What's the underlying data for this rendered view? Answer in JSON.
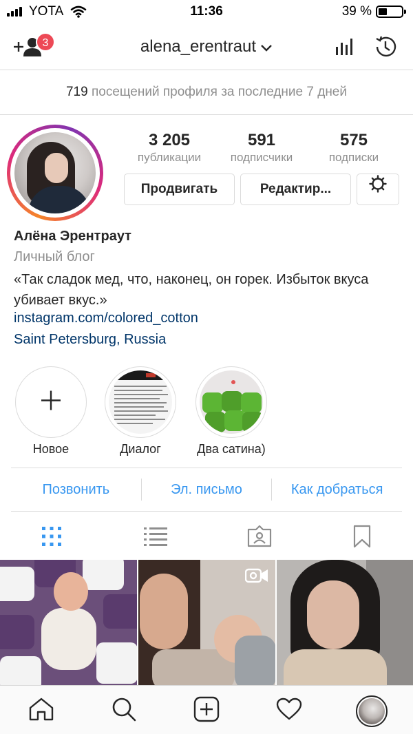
{
  "status_bar": {
    "carrier": "YOTA",
    "time": "11:36",
    "battery_percent": "39 %",
    "battery_level": 0.39
  },
  "header": {
    "username": "alena_erentraut",
    "notification_count": "3",
    "icons": [
      "add-user-icon",
      "chevron-down-icon",
      "insights-icon",
      "archive-history-icon"
    ]
  },
  "visits": {
    "count": "719",
    "text": "посещений профиля за последние 7 дней"
  },
  "profile": {
    "stats": [
      {
        "value": "3 205",
        "label": "публикации"
      },
      {
        "value": "591",
        "label": "подписчики"
      },
      {
        "value": "575",
        "label": "подписки"
      }
    ],
    "buttons": {
      "promote": "Продвигать",
      "edit": "Редактир..."
    },
    "full_name": "Алёна Эрентраут",
    "category": "Личный блог",
    "bio": "«Так сладок мед, что, наконец, он горек. Избыток вкуса убивает вкус.»",
    "link": "instagram.com/colored_cotton",
    "location": "Saint Petersburg, Russia"
  },
  "highlights": [
    {
      "label": "Новое"
    },
    {
      "label": "Диалог"
    },
    {
      "label": "Два сатина)"
    }
  ],
  "contact": {
    "call": "Позвонить",
    "email": "Эл. письмо",
    "directions": "Как добраться"
  },
  "tabs": [
    "grid-icon",
    "list-icon",
    "tagged-icon",
    "saved-icon"
  ],
  "colors": {
    "accent": "#3897f0",
    "link": "#003569",
    "badge": "#ed4956",
    "muted": "#8e8e8e",
    "text": "#262626",
    "border": "#dbdbdb"
  },
  "bottom_nav": [
    "home-icon",
    "search-icon",
    "new-post-icon",
    "activity-heart-icon",
    "profile-avatar"
  ]
}
